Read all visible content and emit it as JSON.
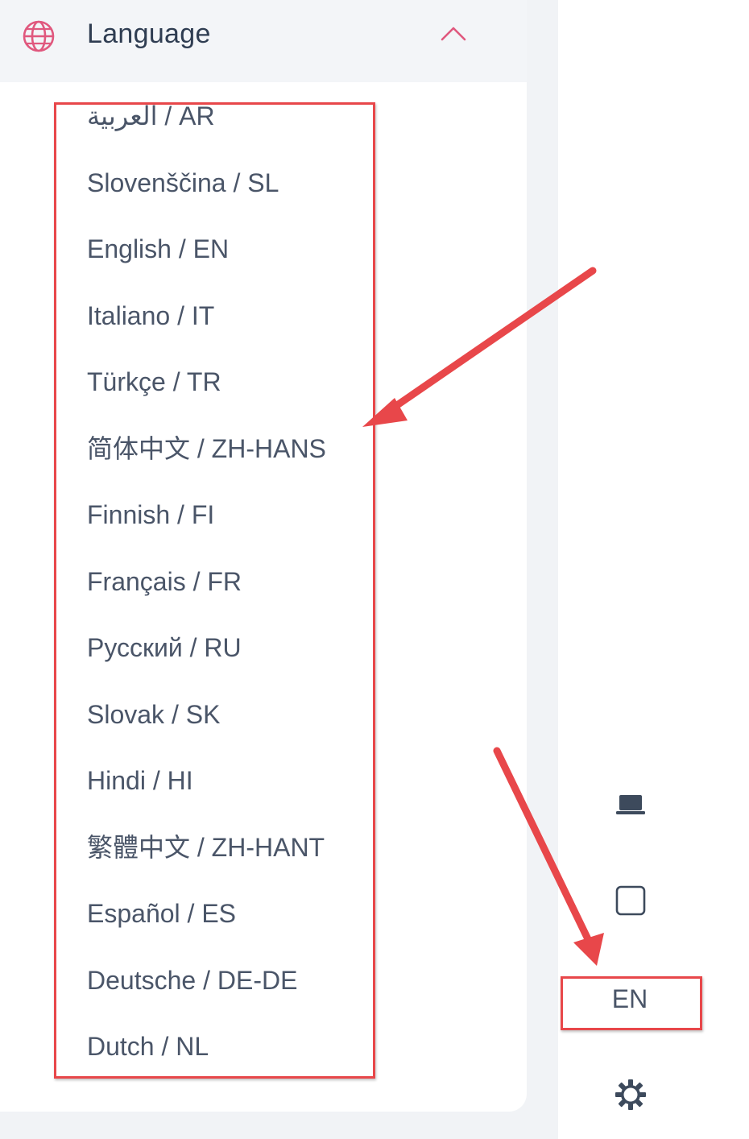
{
  "header": {
    "label": "Language",
    "icon": "globe-icon",
    "toggle_icon": "chevron-up-icon",
    "accent_color": "#e0587e"
  },
  "languages": [
    {
      "label": "العربية / AR"
    },
    {
      "label": "Slovenščina / SL"
    },
    {
      "label": "English / EN"
    },
    {
      "label": "Italiano / IT"
    },
    {
      "label": "Türkçe / TR"
    },
    {
      "label": "简体中文 / ZH-HANS"
    },
    {
      "label": "Finnish / FI"
    },
    {
      "label": "Français / FR"
    },
    {
      "label": "Русский / RU"
    },
    {
      "label": "Slovak / SK"
    },
    {
      "label": "Hindi / HI"
    },
    {
      "label": "繁體中文 / ZH-HANT"
    },
    {
      "label": "Español / ES"
    },
    {
      "label": "Deutsche / DE-DE"
    },
    {
      "label": "Dutch / NL"
    }
  ],
  "sidebar": {
    "laptop_icon": "laptop-icon",
    "square_icon": "square-icon",
    "language_code": "EN",
    "settings_icon": "gear-icon"
  },
  "annotations": {
    "color": "#e8474a"
  }
}
